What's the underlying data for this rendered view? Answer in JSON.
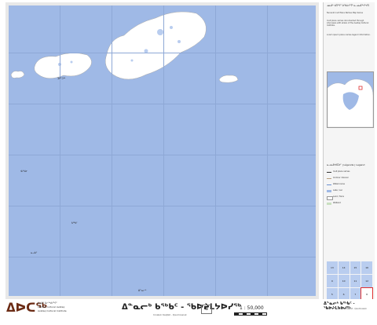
{
  "logo": {
    "syllabics": "ᐃᐅᑕᖅ",
    "org_lines": [
      "ᐃᓄᐃᑦ ᐃᓕᖅᑯᓯᖏᑦ",
      "Institut culturel Avataq",
      "Avataq Cultural Institute"
    ]
  },
  "title": {
    "main": "ᐃᓐᓇᓕᒃ ᑲᖅᑲᑦ - ᖃᐅᔨᒪᔭᐅᓯᖅ",
    "sub": "Innaluk Kaqtat - Qaumiusiuk",
    "number": "8",
    "scale": "1 : 50,000"
  },
  "footer_right": {
    "title": "ᐃᓐᓇᓕᒃ ᑲᖅᑲᑦ - ᖃᐅᔨᒪᔭᐅᓯᖅ",
    "sub": "Innaluk Kaqtat - Qaumiusiuk"
  },
  "panel": {
    "title": "ᓄᓇᕕᒃ ᐊᑎᖏᑦ ᐅᖃᐅᓯᕐᒥᒃ ᓇᓗᓇᐃᖅᓯᔾᔪᑎ",
    "text_blocks": [
      "Nunavik Inuit Place Names Map Series",
      "Inuit place names documented through interviews with elders of the Avataq Cultural Institute.",
      "Lorem ipsum place names legend information."
    ],
    "legend_title": "ᓇᓗᓇᐃᒃᑯᑕᐅᑦ | Légende | Legend",
    "legend": [
      {
        "label": "Inuit place names",
        "color": "#333333"
      },
      {
        "label": "Contour interval",
        "color": "#b8a080"
      },
      {
        "label": "Watercourse",
        "color": "#6a8fd0"
      },
      {
        "label": "Lake / Lac",
        "color": "#9fb9e6"
      },
      {
        "label": "Land / Terre",
        "color": "#ffffff"
      },
      {
        "label": "Wetland",
        "color": "#c9e0c0"
      }
    ],
    "index_cells": [
      "13",
      "14",
      "15",
      "16",
      "9",
      "10",
      "11",
      "12",
      "5",
      "6",
      "7",
      "8"
    ],
    "active_index": "8"
  },
  "map": {
    "places": [
      {
        "name": "ᑐᑭᑦᑐᖅ"
      },
      {
        "name": "ᐊᓯᐊᓂ"
      },
      {
        "name": "ᑲᖅᑲᑦ"
      },
      {
        "name": "ᓇᓗᑲᑦ"
      },
      {
        "name": "ᐃᓐᓇᓕᒃ"
      }
    ]
  }
}
